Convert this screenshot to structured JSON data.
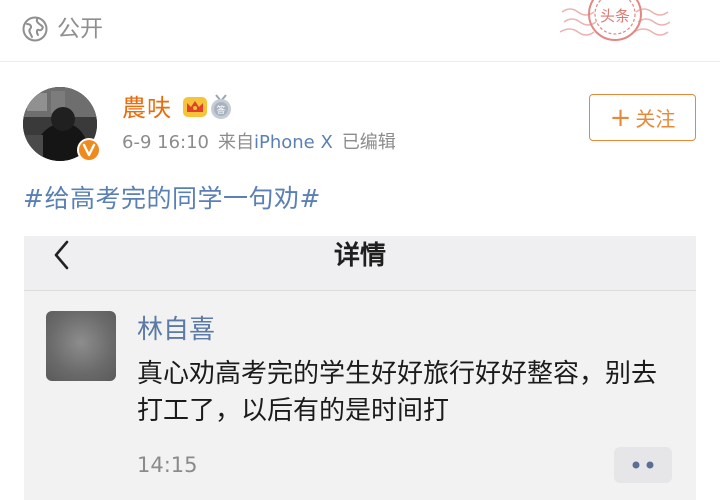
{
  "visibility": {
    "label": "公开",
    "icon": "globe-icon"
  },
  "stamp": {
    "text": "头条",
    "icon": "stamp-icon"
  },
  "post": {
    "username": "農呋",
    "date": "6-9 16:10",
    "source_prefix": "来自",
    "source": "iPhone X",
    "edited": "已编辑",
    "follow_label": "关注",
    "hashtag": "#给高考完的同学一句劝#"
  },
  "embedded": {
    "title": "详情",
    "comment": {
      "name": "林自喜",
      "text": "真心劝高考完的学生好好旅行好好整容，别去打工了，以后有的是时间打",
      "time": "14:15"
    }
  },
  "colors": {
    "username": "#e86b0c",
    "link": "#5b80b6",
    "follow": "#e8893a",
    "stamp": "#d9605a"
  }
}
